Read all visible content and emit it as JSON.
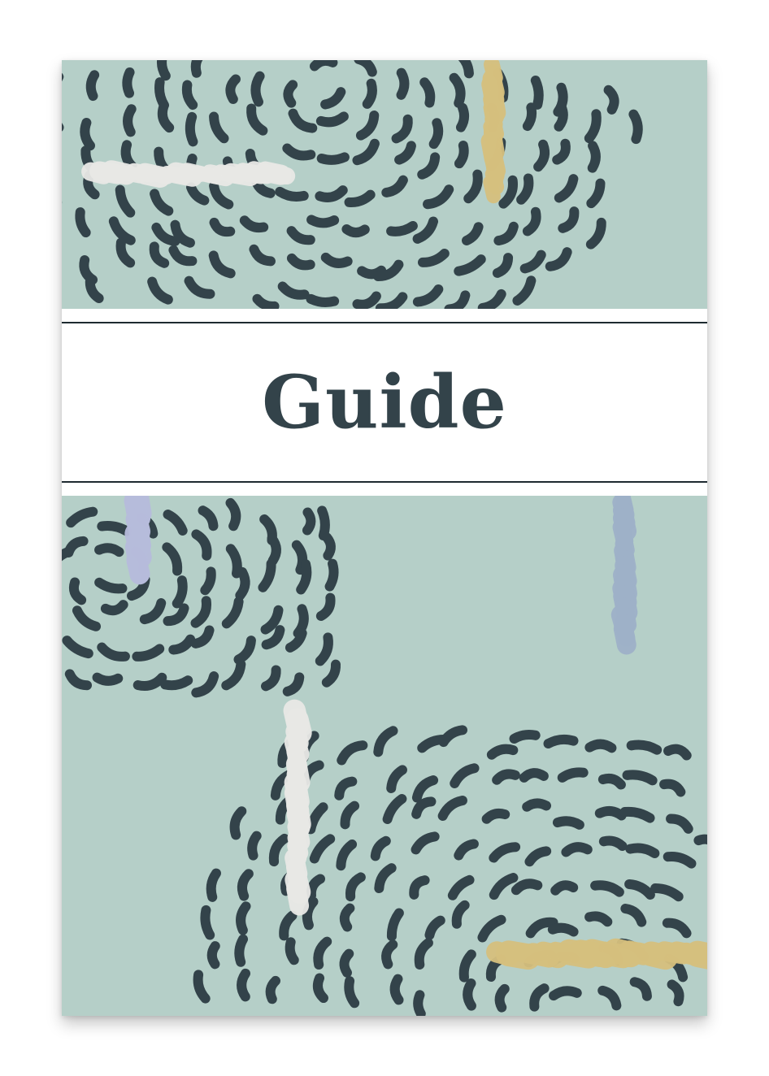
{
  "cover": {
    "title": "Guide"
  },
  "colors": {
    "background": "#b5cfc8",
    "dash": "#33434a",
    "band": "#ffffff",
    "rule": "#1e2a30",
    "brush_gold": "#d6c07e",
    "brush_white": "#e9e9e6",
    "brush_lavender": "#b7bcdc",
    "brush_blue": "#9eb1c9"
  },
  "decorations": {
    "pattern": "curved-dash-pattern",
    "brush_strokes": [
      "white",
      "gold",
      "lavender",
      "blue",
      "white",
      "gold"
    ]
  }
}
